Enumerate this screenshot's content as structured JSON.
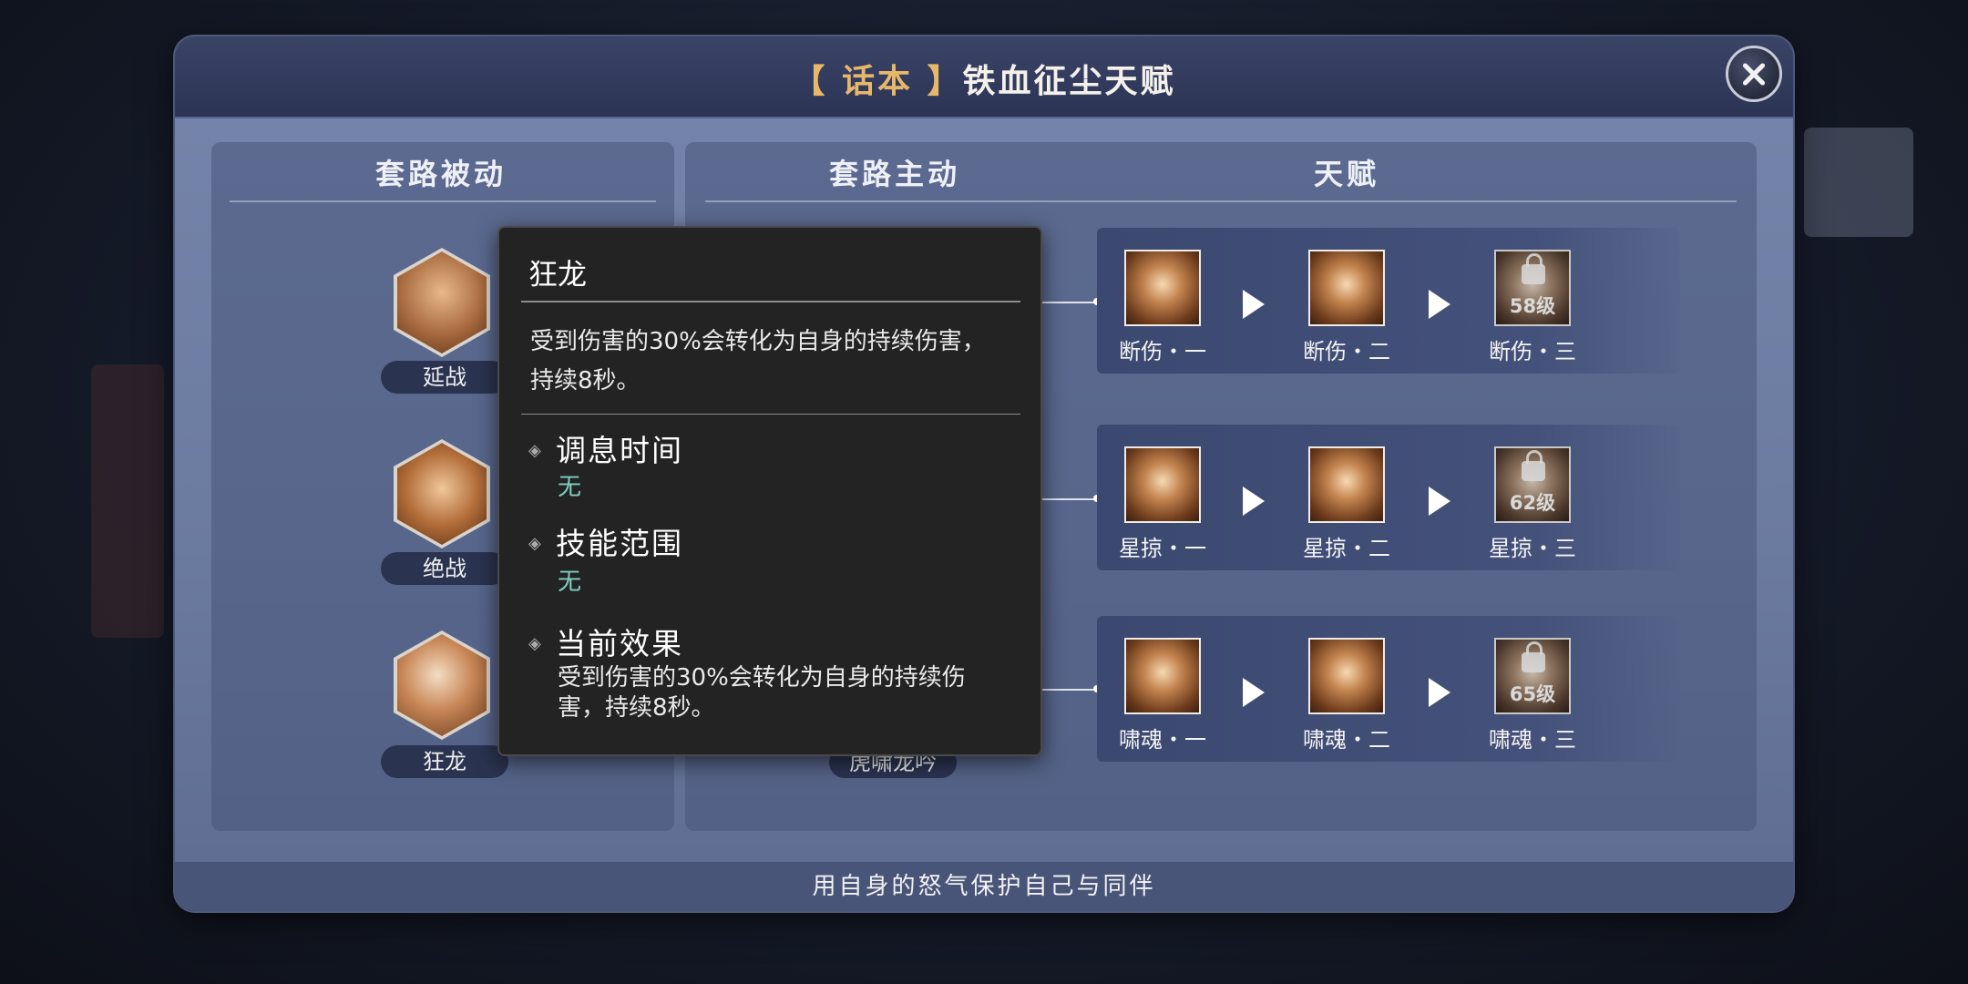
{
  "dialog": {
    "title_tag": "【 话本 】",
    "title_text": "铁血征尘天赋",
    "footer": "用自身的怒气保护自己与同伴"
  },
  "columns": {
    "passive": "套路被动",
    "active": "套路主动",
    "talent": "天赋"
  },
  "passives": [
    {
      "label": "延战",
      "icon": "warrior-silhouette-icon"
    },
    {
      "label": "绝战",
      "icon": "swirl-blade-icon"
    },
    {
      "label": "狂龙",
      "icon": "sword-strike-icon"
    }
  ],
  "active_skill_label": "虎啸龙吟",
  "talent_rows": [
    {
      "skills": [
        {
          "label": "断伤・一",
          "locked": false
        },
        {
          "label": "断伤・二",
          "locked": false
        },
        {
          "label": "断伤・三",
          "locked": true,
          "level": "58级"
        }
      ]
    },
    {
      "skills": [
        {
          "label": "星掠・一",
          "locked": false
        },
        {
          "label": "星掠・二",
          "locked": false
        },
        {
          "label": "星掠・三",
          "locked": true,
          "level": "62级"
        }
      ]
    },
    {
      "skills": [
        {
          "label": "啸魂・一",
          "locked": false
        },
        {
          "label": "啸魂・二",
          "locked": false
        },
        {
          "label": "啸魂・三",
          "locked": true,
          "level": "65级"
        }
      ]
    }
  ],
  "tooltip": {
    "title": "狂龙",
    "description": "受到伤害的30%会转化为自身的持续伤害，持续8秒。",
    "cooldown_label": "调息时间",
    "cooldown_value": "无",
    "range_label": "技能范围",
    "range_value": "无",
    "effect_label": "当前效果",
    "effect_value": "受到伤害的30%会转化为自身的持续伤害，持续8秒。"
  },
  "colors": {
    "title_tag": "#e7b86a",
    "tooltip_value": "#7fcfc0",
    "panel": "#6c7ba0"
  }
}
